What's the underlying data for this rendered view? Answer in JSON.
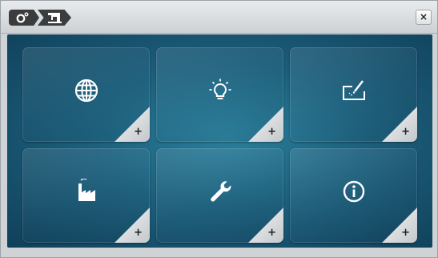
{
  "topbar": {
    "breadcrumbs": [
      {
        "icon": "settings-icon"
      },
      {
        "icon": "sewing-machine-icon"
      }
    ],
    "close_label": "×"
  },
  "tiles": [
    {
      "id": "language",
      "icon": "globe-icon",
      "badge": "+"
    },
    {
      "id": "display",
      "icon": "light-bulb-icon",
      "badge": "+"
    },
    {
      "id": "calibrate",
      "icon": "touch-pen-icon",
      "badge": "+"
    },
    {
      "id": "factory",
      "icon": "factory-icon",
      "badge": "+"
    },
    {
      "id": "service",
      "icon": "wrench-icon",
      "badge": "+"
    },
    {
      "id": "info",
      "icon": "info-icon",
      "badge": "+"
    }
  ],
  "colors": {
    "panel_center": "#2a7f9c",
    "panel_edge": "#10405a",
    "crumb": "#3a3c3e"
  }
}
